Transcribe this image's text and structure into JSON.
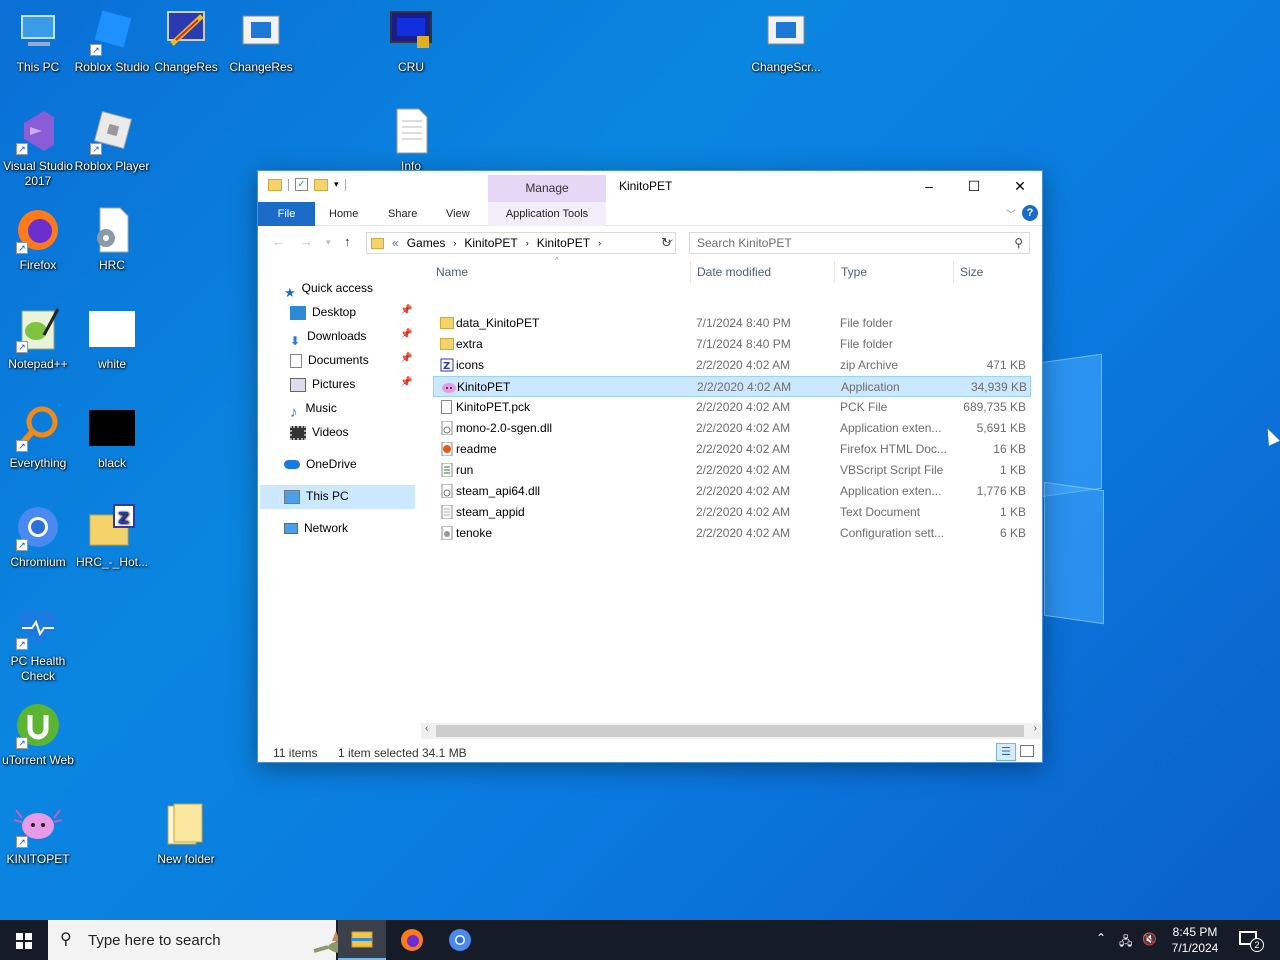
{
  "desktop": {
    "icons": [
      {
        "label": "This PC",
        "icon": "this-pc-icon"
      },
      {
        "label": "Roblox Studio",
        "icon": "roblox-studio-icon"
      },
      {
        "label": "ChangeRes",
        "icon": "changeres-app-icon"
      },
      {
        "label": "ChangeRes",
        "icon": "changeres-window-icon"
      },
      {
        "label": "CRU",
        "icon": "cru-monitor-icon"
      },
      {
        "label": "ChangeScr...",
        "icon": "changescr-window-icon"
      },
      {
        "label": "Visual Studio 2017",
        "icon": "visual-studio-icon"
      },
      {
        "label": "Roblox Player",
        "icon": "roblox-player-icon"
      },
      {
        "label": "Info",
        "icon": "text-document-icon"
      },
      {
        "label": "Firefox",
        "icon": "firefox-icon"
      },
      {
        "label": "HRC",
        "icon": "hrc-gear-document-icon"
      },
      {
        "label": "Notepad++",
        "icon": "notepad-plus-plus-icon"
      },
      {
        "label": "white",
        "icon": "white-image-icon"
      },
      {
        "label": "Everything",
        "icon": "everything-search-icon"
      },
      {
        "label": "black",
        "icon": "black-image-icon"
      },
      {
        "label": "Chromium",
        "icon": "chromium-icon"
      },
      {
        "label": "HRC_-_Hot...",
        "icon": "zip-folder-icon"
      },
      {
        "label": "PC Health Check",
        "icon": "pc-health-check-icon"
      },
      {
        "label": "uTorrent Web",
        "icon": "utorrent-icon"
      },
      {
        "label": "KINITOPET",
        "icon": "kinitopet-icon"
      },
      {
        "label": "New folder",
        "icon": "folder-icon"
      }
    ]
  },
  "explorer": {
    "title": "KinitoPET",
    "manage_tab": "Manage",
    "ribbon_tabs": {
      "file": "File",
      "home": "Home",
      "share": "Share",
      "view": "View",
      "app_tools": "Application Tools"
    },
    "address": {
      "overflow": "«",
      "crumbs": [
        "Games",
        "KinitoPET",
        "KinitoPET"
      ]
    },
    "search_placeholder": "Search KinitoPET",
    "nav": {
      "quick_access": "Quick access",
      "desktop": "Desktop",
      "downloads": "Downloads",
      "documents": "Documents",
      "pictures": "Pictures",
      "music": "Music",
      "videos": "Videos",
      "onedrive": "OneDrive",
      "this_pc": "This PC",
      "network": "Network"
    },
    "columns": {
      "name": "Name",
      "date": "Date modified",
      "type": "Type",
      "size": "Size"
    },
    "files": [
      {
        "name": "data_KinitoPET",
        "date": "7/1/2024 8:40 PM",
        "type": "File folder",
        "size": "",
        "icon": "folder"
      },
      {
        "name": "extra",
        "date": "7/1/2024 8:40 PM",
        "type": "File folder",
        "size": "",
        "icon": "folder"
      },
      {
        "name": "icons",
        "date": "2/2/2020 4:02 AM",
        "type": "zip Archive",
        "size": "471 KB",
        "icon": "zip"
      },
      {
        "name": "KinitoPET",
        "date": "2/2/2020 4:02 AM",
        "type": "Application",
        "size": "34,939 KB",
        "icon": "app"
      },
      {
        "name": "KinitoPET.pck",
        "date": "2/2/2020 4:02 AM",
        "type": "PCK File",
        "size": "689,735 KB",
        "icon": "doc"
      },
      {
        "name": "mono-2.0-sgen.dll",
        "date": "2/2/2020 4:02 AM",
        "type": "Application exten...",
        "size": "5,691 KB",
        "icon": "dll"
      },
      {
        "name": "readme",
        "date": "2/2/2020 4:02 AM",
        "type": "Firefox HTML Doc...",
        "size": "16 KB",
        "icon": "html"
      },
      {
        "name": "run",
        "date": "2/2/2020 4:02 AM",
        "type": "VBScript Script File",
        "size": "1 KB",
        "icon": "script"
      },
      {
        "name": "steam_api64.dll",
        "date": "2/2/2020 4:02 AM",
        "type": "Application exten...",
        "size": "1,776 KB",
        "icon": "dll"
      },
      {
        "name": "steam_appid",
        "date": "2/2/2020 4:02 AM",
        "type": "Text Document",
        "size": "1 KB",
        "icon": "txt"
      },
      {
        "name": "tenoke",
        "date": "2/2/2020 4:02 AM",
        "type": "Configuration sett...",
        "size": "6 KB",
        "icon": "config"
      }
    ],
    "selected_index": 3,
    "status": {
      "items": "11 items",
      "selected": "1 item selected",
      "size": "34.1 MB"
    }
  },
  "taskbar": {
    "search_placeholder": "Type here to search",
    "clock_time": "8:45 PM",
    "clock_date": "7/1/2024",
    "notification_count": "2"
  },
  "colors": {
    "accent": "#1a6cc8",
    "selection": "#cce8ff",
    "manage_tab": "#e5d7f5"
  }
}
